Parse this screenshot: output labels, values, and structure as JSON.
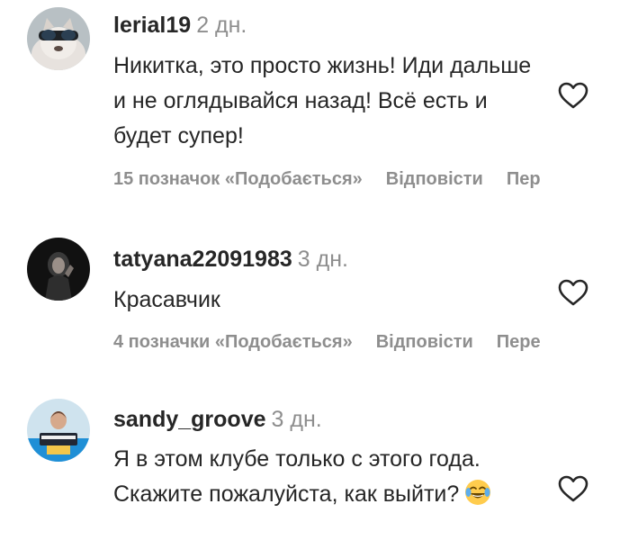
{
  "comments": [
    {
      "username": "lerial19",
      "time": "2 дн.",
      "text": "Никитка, это просто жизнь! Иди дальше и не оглядывайся назад! Всё есть и будет супер!",
      "likes": "15 позначок «Подобається»",
      "reply": "Відповісти",
      "translate": "Пер"
    },
    {
      "username": "tatyana22091983",
      "time": "3 дн.",
      "text": "Красавчик",
      "likes": "4 позначки «Подобається»",
      "reply": "Відповісти",
      "translate": "Пере"
    },
    {
      "username": "sandy_groove",
      "time": "3 дн.",
      "text": "Я в этом клубе только с этого года. Скажите пожалуйста, как выйти?",
      "emoji": "😂"
    }
  ],
  "icons": {
    "like": "heart-outline-icon",
    "emoji": "face-with-tears-of-joy-emoji"
  },
  "colors": {
    "text": "#262626",
    "secondary": "#8e8e8e",
    "emoji_face": "#ffcc4d"
  }
}
